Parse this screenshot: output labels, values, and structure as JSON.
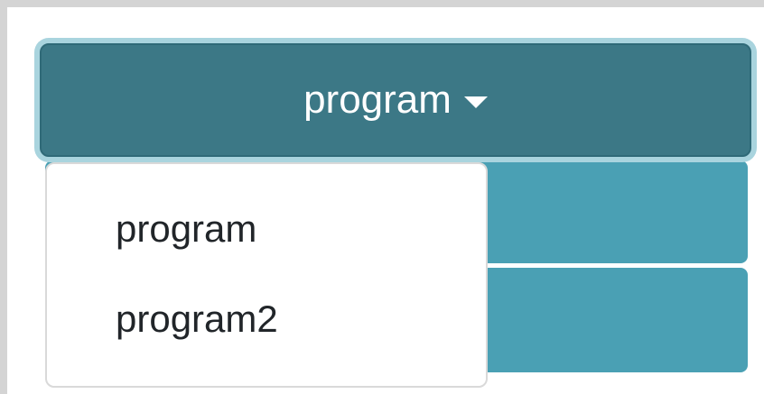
{
  "dropdown": {
    "selected_label": "program",
    "options": [
      {
        "label": "program"
      },
      {
        "label": "program2"
      }
    ]
  },
  "colors": {
    "toggle_bg": "#3c7886",
    "focus_ring": "#a9d4de",
    "row_bg": "#4aa0b4",
    "menu_bg": "#ffffff",
    "menu_text": "#212529"
  },
  "icons": {
    "toggle_caret": "caret-down-icon"
  }
}
